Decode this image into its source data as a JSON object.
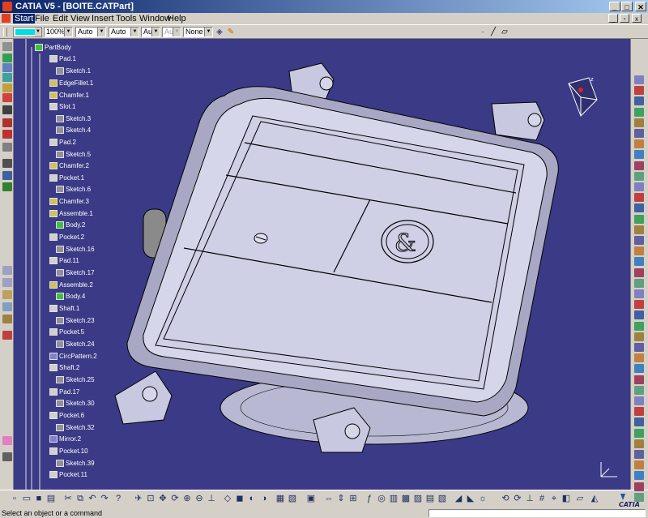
{
  "window": {
    "title": "CATIA V5 - [BOITE.CATPart]",
    "minimize": "_",
    "maximize": "□",
    "close": "✕"
  },
  "menu": [
    {
      "label": "Start"
    },
    {
      "label": "File"
    },
    {
      "label": "Edit"
    },
    {
      "label": "View"
    },
    {
      "label": "Insert"
    },
    {
      "label": "Tools"
    },
    {
      "label": "Window"
    },
    {
      "label": "Help"
    }
  ],
  "properties": {
    "color_hex": "#00e0e0",
    "transparency": "100%",
    "linetype": "Auto",
    "thickness": "Auto",
    "point_symbol": "Aut",
    "disabled_field": "Aut",
    "layer": "None"
  },
  "tree": [
    {
      "label": "PartBody",
      "icon": "partbody-icon",
      "color": "#40c040"
    },
    {
      "label": "Pad.1",
      "icon": "pad-icon",
      "color": "#d0d0d0"
    },
    {
      "label": "Sketch.1",
      "icon": "sketch-icon",
      "color": "#9090a0"
    },
    {
      "label": "EdgeFillet.1",
      "icon": "fillet-icon",
      "color": "#d0c060"
    },
    {
      "label": "Chamfer.1",
      "icon": "chamfer-icon",
      "color": "#d0c060"
    },
    {
      "label": "Slot.1",
      "icon": "slot-icon",
      "color": "#d0d0d0"
    },
    {
      "label": "Sketch.3",
      "icon": "sketch-icon",
      "color": "#9090a0"
    },
    {
      "label": "Sketch.4",
      "icon": "sketch-icon",
      "color": "#9090a0"
    },
    {
      "label": "Pad.2",
      "icon": "pad-icon",
      "color": "#d0d0d0"
    },
    {
      "label": "Sketch.5",
      "icon": "sketch-icon",
      "color": "#9090a0"
    },
    {
      "label": "Chamfer.2",
      "icon": "chamfer-icon",
      "color": "#d0c060"
    },
    {
      "label": "Pocket.1",
      "icon": "pocket-icon",
      "color": "#d0d0d0"
    },
    {
      "label": "Sketch.6",
      "icon": "sketch-icon",
      "color": "#9090a0"
    },
    {
      "label": "Chamfer.3",
      "icon": "chamfer-icon",
      "color": "#d0c060"
    },
    {
      "label": "Assemble.1",
      "icon": "assemble-icon",
      "color": "#d0c060"
    },
    {
      "label": "Body.2",
      "icon": "body-icon",
      "color": "#40c040"
    },
    {
      "label": "Pocket.2",
      "icon": "pocket-icon",
      "color": "#d0d0d0"
    },
    {
      "label": "Sketch.16",
      "icon": "sketch-icon",
      "color": "#9090a0"
    },
    {
      "label": "Pad.11",
      "icon": "pad-icon",
      "color": "#d0d0d0"
    },
    {
      "label": "Sketch.17",
      "icon": "sketch-icon",
      "color": "#9090a0"
    },
    {
      "label": "Assemble.2",
      "icon": "assemble-icon",
      "color": "#d0c060"
    },
    {
      "label": "Body.4",
      "icon": "body-icon",
      "color": "#40c040"
    },
    {
      "label": "Shaft.1",
      "icon": "shaft-icon",
      "color": "#d0d0d0"
    },
    {
      "label": "Sketch.23",
      "icon": "sketch-icon",
      "color": "#9090a0"
    },
    {
      "label": "Pocket.5",
      "icon": "pocket-icon",
      "color": "#d0d0d0"
    },
    {
      "label": "Sketch.24",
      "icon": "sketch-icon",
      "color": "#9090a0"
    },
    {
      "label": "CircPattern.2",
      "icon": "pattern-icon",
      "color": "#8080d0"
    },
    {
      "label": "Shaft.2",
      "icon": "shaft-icon",
      "color": "#d0d0d0"
    },
    {
      "label": "Sketch.25",
      "icon": "sketch-icon",
      "color": "#9090a0"
    },
    {
      "label": "Pad.17",
      "icon": "pad-icon",
      "color": "#d0d0d0"
    },
    {
      "label": "Sketch.30",
      "icon": "sketch-icon",
      "color": "#9090a0"
    },
    {
      "label": "Pocket.6",
      "icon": "pocket-icon",
      "color": "#d0d0d0"
    },
    {
      "label": "Sketch.32",
      "icon": "sketch-icon",
      "color": "#9090a0"
    },
    {
      "label": "Mirror.2",
      "icon": "mirror-icon",
      "color": "#8080d0"
    },
    {
      "label": "Pocket.10",
      "icon": "pocket-icon",
      "color": "#d0d0d0"
    },
    {
      "label": "Sketch.39",
      "icon": "sketch-icon",
      "color": "#9090a0"
    },
    {
      "label": "Pocket.11",
      "icon": "pocket-icon",
      "color": "#d0d0d0"
    }
  ],
  "colors": {
    "background": "#3a3a86",
    "model_face": "#d6d6ea",
    "model_shade": "#a8a8c4",
    "model_edge": "#000000",
    "title_start": "#0a246a",
    "title_end": "#a6caf0"
  },
  "status": {
    "message": "Select an object or a command"
  },
  "branding": {
    "catia_logo": "CATIA"
  }
}
